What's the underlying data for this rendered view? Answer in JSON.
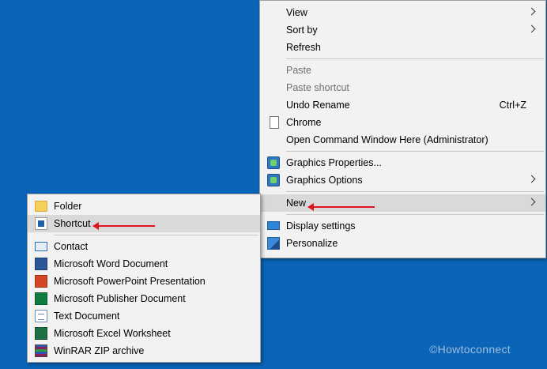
{
  "colors": {
    "desktop": "#0b64b7",
    "menu_bg": "#f2f2f2",
    "highlight": "#d9d9d9",
    "arrow": "#e0141e"
  },
  "context_menu": {
    "view": "View",
    "sort_by": "Sort by",
    "refresh": "Refresh",
    "paste": "Paste",
    "paste_shortcut": "Paste shortcut",
    "undo_rename": "Undo Rename",
    "undo_shortcut_key": "Ctrl+Z",
    "chrome": "Chrome",
    "open_cmd": "Open Command Window Here (Administrator)",
    "graphics_properties": "Graphics Properties...",
    "graphics_options": "Graphics Options",
    "new": "New",
    "display_settings": "Display settings",
    "personalize": "Personalize"
  },
  "new_submenu": {
    "folder": "Folder",
    "shortcut": "Shortcut",
    "contact": "Contact",
    "word": "Microsoft Word Document",
    "powerpoint": "Microsoft PowerPoint Presentation",
    "publisher": "Microsoft Publisher Document",
    "text": "Text Document",
    "excel": "Microsoft Excel Worksheet",
    "winrar": "WinRAR ZIP archive"
  },
  "icons": {
    "chrome": "blank-document-icon",
    "graphics": "intel-graphics-icon",
    "display": "display-icon",
    "personalize": "personalize-icon",
    "folder": "folder-icon",
    "shortcut": "shortcut-icon",
    "contact": "contact-icon",
    "word": "word-icon",
    "powerpoint": "powerpoint-icon",
    "publisher": "publisher-icon",
    "text": "text-document-icon",
    "excel": "excel-icon",
    "winrar": "winrar-icon"
  },
  "watermark": "©Howtoconnect"
}
